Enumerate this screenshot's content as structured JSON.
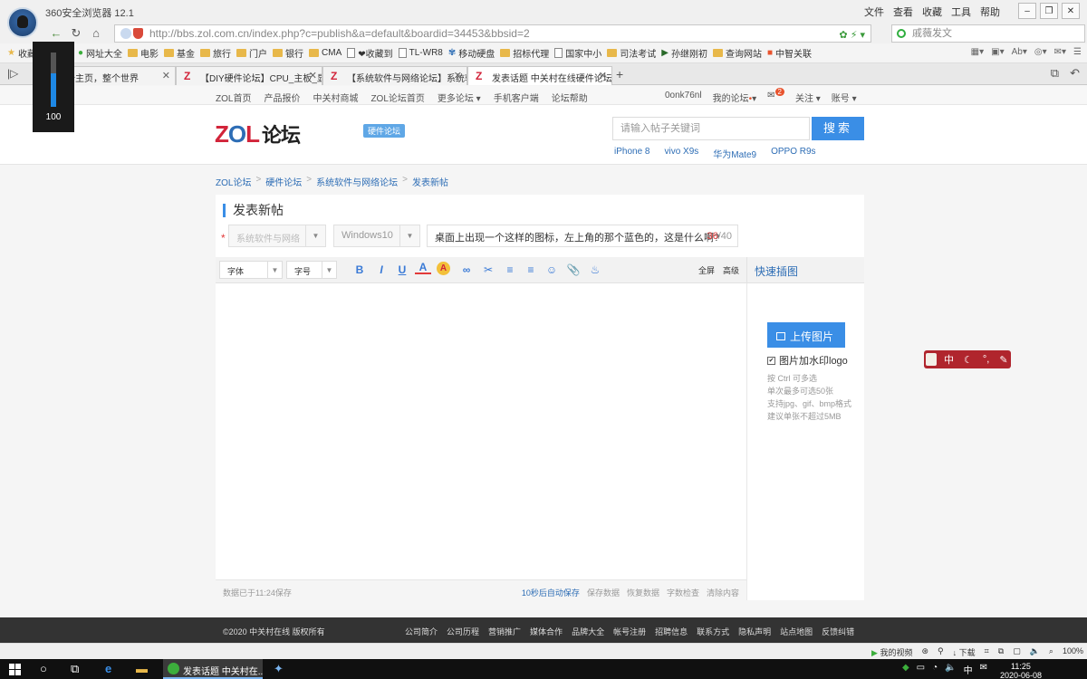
{
  "browser": {
    "title": "360安全浏览器 12.1",
    "menu": [
      "文件",
      "查看",
      "收藏",
      "工具",
      "帮助"
    ],
    "url": "http://bbs.zol.com.cn/index.php?c=publish&a=default&boardid=34453&bbsid=2",
    "search_placeholder": "戚薇发文",
    "bookmarks": [
      "收藏",
      "网址大全",
      "电影",
      "基金",
      "旅行",
      "门户",
      "银行",
      "CMA",
      "❤收藏到",
      "TL-WR8",
      "移动硬盘",
      "招标代理",
      "国家中小",
      "司法考试",
      "孙继刚初",
      "查询网站",
      "中智关联"
    ],
    "tabs": [
      {
        "label": "一个主页，整个世界"
      },
      {
        "label": "【DIY硬件论坛】CPU_主板_显卡"
      },
      {
        "label": "【系统软件与网络论坛】系统软"
      },
      {
        "label": "发表话题 中关村在线硬件论坛"
      }
    ],
    "volume": "100",
    "volume_level": 0.62
  },
  "topnav": {
    "left": [
      "ZOL首页",
      "产品报价",
      "中关村商城",
      "ZOL论坛首页",
      "更多论坛 ▾",
      "手机客户端",
      "论坛帮助"
    ],
    "user": "0onk76nl",
    "my_forum": "我的论坛",
    "msg_count": "2",
    "follow": "关注 ▾",
    "account": "账号 ▾"
  },
  "header": {
    "logo_z": "Z",
    "logo_o": "O",
    "logo_l": "L",
    "logo_cn": "论坛",
    "tag": "硬件论坛",
    "search_placeholder": "请输入帖子关键词",
    "search_btn": "搜索",
    "hot_words": [
      "iPhone 8",
      "vivo X9s",
      "华为Mate9",
      "OPPO R9s"
    ]
  },
  "breadcrumb": [
    "ZOL论坛",
    "硬件论坛",
    "系统软件与网络论坛",
    "发表新帖"
  ],
  "editor": {
    "heading": "发表新帖",
    "category": "系统软件与网络",
    "subcategory": "Windows10",
    "title_value": "桌面上出现一个这样的图标，左上角的那个蓝色的，这是什么啊?",
    "count_used": "36",
    "count_max": "/40",
    "font_label": "字体",
    "size_label": "字号",
    "tool_icons": [
      "B",
      "I",
      "U",
      "A",
      "A",
      "∞",
      "✂",
      "≡",
      "≡",
      "☺",
      "📎",
      "♨"
    ],
    "fullscreen": "全屏",
    "advanced": "高级",
    "quick_image": "快速插图",
    "upload_btn": "上传图片",
    "watermark": "图片加水印logo",
    "hints": [
      "按 Ctrl 可多选",
      "单次最多可选50张",
      "支持jpg、gif、bmp格式",
      "建议单张不超过5MB"
    ],
    "saved_text": "数据已于11:24保存",
    "autosave": "10秒后自动保存",
    "actions": [
      "保存数据",
      "恢复数据",
      "字数检查",
      "清除内容"
    ]
  },
  "footer": {
    "copyright": "©2020 中关村在线 版权所有",
    "links": [
      "公司简介",
      "公司历程",
      "营销推广",
      "媒体合作",
      "品牌大全",
      "帐号注册",
      "招聘信息",
      "联系方式",
      "隐私声明",
      "站点地图",
      "反馈纠错"
    ]
  },
  "ime": {
    "label": "中"
  },
  "status_bar": [
    "我的视频",
    "下载",
    "100%"
  ],
  "taskbar": {
    "active_task": "发表话题 中关村在...",
    "time": "11:25",
    "date": "2020-06-08",
    "ime": "中"
  }
}
